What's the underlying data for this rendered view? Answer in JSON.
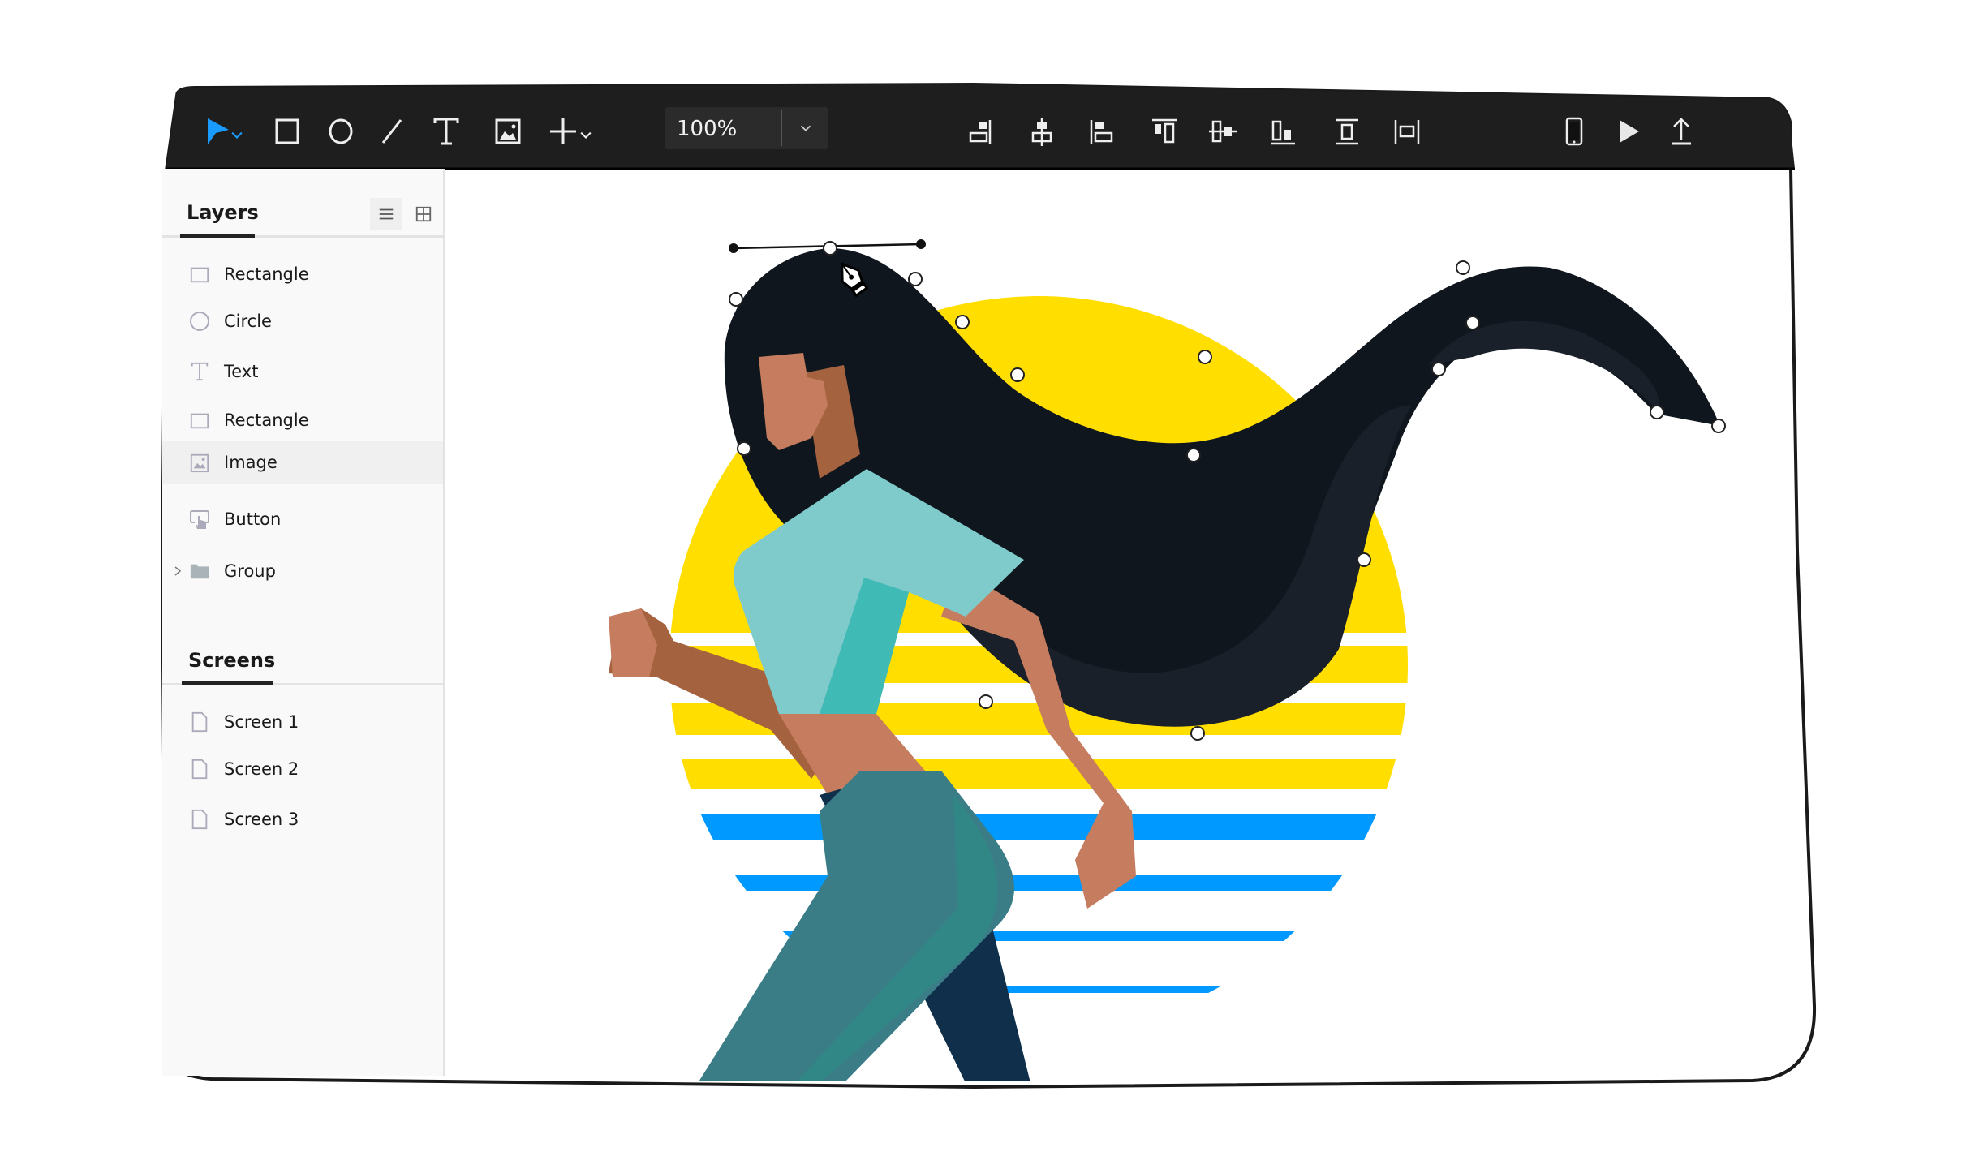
{
  "toolbar": {
    "tools": [
      {
        "name": "select-tool",
        "icon": "pointer-arrow-icon",
        "has_dropdown": true,
        "active": true
      },
      {
        "name": "rectangle-tool",
        "icon": "rectangle-icon"
      },
      {
        "name": "ellipse-tool",
        "icon": "circle-icon"
      },
      {
        "name": "line-tool",
        "icon": "line-icon"
      },
      {
        "name": "text-tool",
        "icon": "text-icon"
      },
      {
        "name": "image-tool",
        "icon": "image-icon"
      },
      {
        "name": "add-tool",
        "icon": "plus-icon",
        "has_dropdown": true
      }
    ],
    "zoom": {
      "value": "100%"
    },
    "align_tools": [
      {
        "name": "align-right",
        "icon": "align-right-icon"
      },
      {
        "name": "align-center-horizontal",
        "icon": "align-center-horizontal-icon"
      },
      {
        "name": "align-left",
        "icon": "align-left-icon"
      },
      {
        "name": "align-top",
        "icon": "align-top-icon"
      },
      {
        "name": "align-center-vertical",
        "icon": "align-center-vertical-icon"
      },
      {
        "name": "align-bottom",
        "icon": "align-bottom-icon"
      },
      {
        "name": "distribute-vertical",
        "icon": "distribute-vertical-icon"
      },
      {
        "name": "distribute-horizontal",
        "icon": "distribute-horizontal-icon"
      }
    ],
    "right_tools": [
      {
        "name": "device-preview",
        "icon": "phone-icon"
      },
      {
        "name": "play-preview",
        "icon": "play-icon"
      },
      {
        "name": "export",
        "icon": "upload-icon"
      }
    ],
    "accent_color": "#1a9bff",
    "background_color": "#1e1e1e"
  },
  "layers_panel": {
    "title": "Layers",
    "view_modes": [
      "list-view",
      "grid-view"
    ],
    "active_view": "list-view",
    "items": [
      {
        "label": "Rectangle",
        "icon": "rectangle-icon"
      },
      {
        "label": "Circle",
        "icon": "circle-icon"
      },
      {
        "label": "Text",
        "icon": "text-icon"
      },
      {
        "label": "Rectangle",
        "icon": "rectangle-icon"
      },
      {
        "label": "Image",
        "icon": "image-icon",
        "selected": true
      },
      {
        "label": "Button",
        "icon": "button-tap-icon"
      },
      {
        "label": "Group",
        "icon": "folder-icon",
        "expandable": true
      }
    ]
  },
  "screens_panel": {
    "title": "Screens",
    "items": [
      {
        "label": "Screen 1",
        "icon": "page-icon"
      },
      {
        "label": "Screen 2",
        "icon": "page-icon"
      },
      {
        "label": "Screen 3",
        "icon": "page-icon"
      }
    ]
  },
  "canvas": {
    "illustration": "woman-running-with-flowing-hair-sunset",
    "active_tool_cursor": "pen-nib-icon",
    "colors": {
      "sun_yellow": "#ffde00",
      "stripe_blue": "#0099ff",
      "hair": "#0f161e",
      "hair_shade": "#1a2029",
      "skin": "#c67c5e",
      "skin_shade": "#a5623f",
      "shirt": "#7fcaca",
      "shirt_shade": "#3ab8b3",
      "pants": "#3b7d87",
      "pants_dark": "#0f2f4a"
    }
  }
}
